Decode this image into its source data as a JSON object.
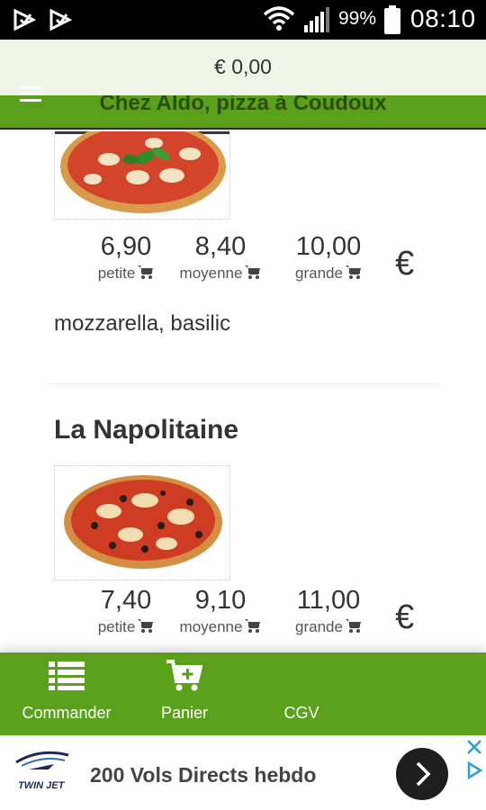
{
  "status_bar": {
    "battery_percent": "99%",
    "clock": "08:10"
  },
  "cart": {
    "total": "€ 0,00"
  },
  "header": {
    "title": "Chez Aldo, pizza à Coudoux"
  },
  "menu": {
    "items": [
      {
        "name": "",
        "image": "pizza-margherita-photo",
        "prices": [
          {
            "value": "6,90",
            "size": "petite"
          },
          {
            "value": "8,40",
            "size": "moyenne"
          },
          {
            "value": "10,00",
            "size": "grande"
          }
        ],
        "currency": "€",
        "ingredients": "mozzarella, basilic"
      },
      {
        "name": "La Napolitaine",
        "image": "pizza-napolitaine-photo",
        "prices": [
          {
            "value": "7,40",
            "size": "petite"
          },
          {
            "value": "9,10",
            "size": "moyenne"
          },
          {
            "value": "11,00",
            "size": "grande"
          }
        ],
        "currency": "€"
      }
    ]
  },
  "bottom_nav": {
    "items": [
      {
        "label": "Commander",
        "icon": "list-icon"
      },
      {
        "label": "Panier",
        "icon": "cart-add-icon"
      },
      {
        "label": "CGV",
        "icon": ""
      }
    ]
  },
  "ad": {
    "brand_logo_text": "TWIN JET",
    "text": "200 Vols Directs hebdo"
  },
  "colors": {
    "brand_green": "#5aa01a",
    "cart_bar_bg": "#eef4e8",
    "title_text": "#2f4d11"
  }
}
